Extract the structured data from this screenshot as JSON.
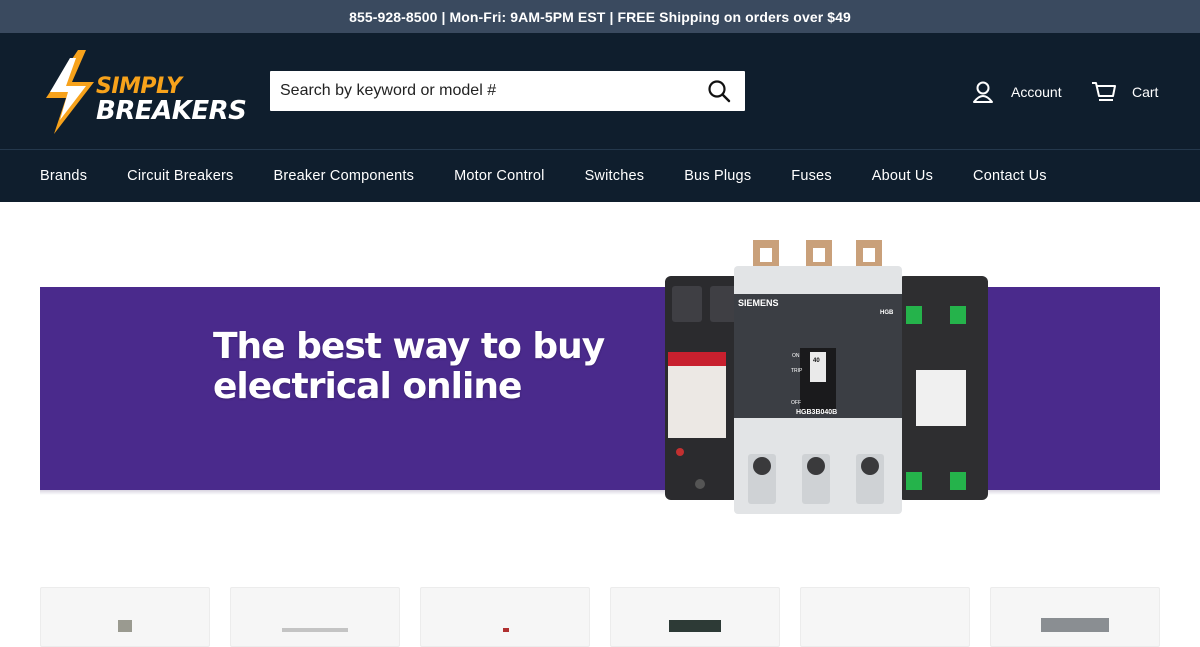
{
  "announcement": "855-928-8500 | Mon-Fri: 9AM-5PM EST | FREE Shipping on orders over $49",
  "brand": {
    "line1": "SIMPLY",
    "line2": "BREAKERS",
    "accent": "#f7a21b"
  },
  "search": {
    "placeholder": "Search by keyword or model #",
    "icon": "search-icon"
  },
  "header_actions": {
    "account_label": "Account",
    "cart_label": "Cart"
  },
  "nav": {
    "items": [
      {
        "label": "Brands"
      },
      {
        "label": "Circuit Breakers"
      },
      {
        "label": "Breaker Components"
      },
      {
        "label": "Motor Control"
      },
      {
        "label": "Switches"
      },
      {
        "label": "Bus Plugs"
      },
      {
        "label": "Fuses"
      },
      {
        "label": "About Us"
      },
      {
        "label": "Contact Us"
      }
    ]
  },
  "hero": {
    "line1": "The best way to buy",
    "line2": "electrical online",
    "bg_color": "#4a2a8c",
    "product_brand": "SIEMENS",
    "product_model": "HGB3B040B",
    "product_type": "HGB",
    "handle_rating": "40",
    "on_label": "ON",
    "off_label": "OFF",
    "trip_label": "TRIP"
  },
  "colors": {
    "header_bg": "#0f1e2d",
    "announce_bg": "#3a4a5f"
  }
}
